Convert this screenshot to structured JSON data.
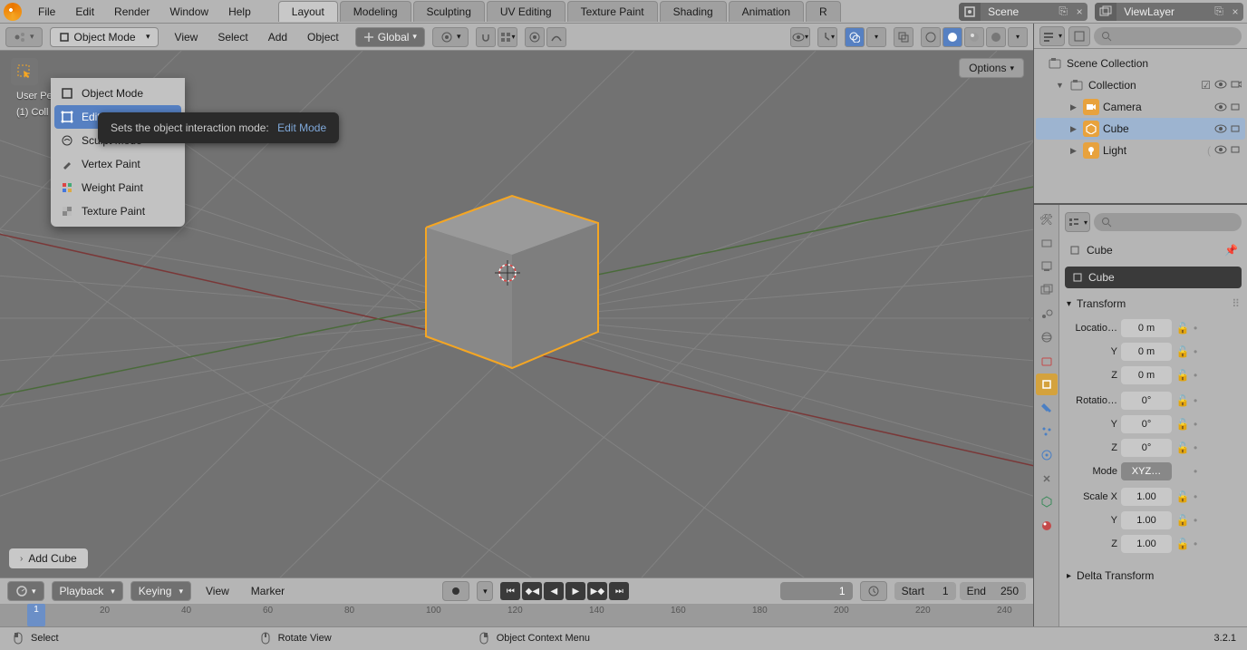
{
  "top_menu": {
    "file": "File",
    "edit": "Edit",
    "render": "Render",
    "window": "Window",
    "help": "Help"
  },
  "workspaces": {
    "layout": "Layout",
    "modeling": "Modeling",
    "sculpting": "Sculpting",
    "uv": "UV Editing",
    "texture": "Texture Paint",
    "shading": "Shading",
    "animation": "Animation",
    "more": "R"
  },
  "scene_name": "Scene",
  "view_layer": "ViewLayer",
  "mode_dropdown_label": "Object Mode",
  "vp_menu": {
    "view": "View",
    "select": "Select",
    "add": "Add",
    "object": "Object"
  },
  "orientation": "Global",
  "options_label": "Options",
  "overlay": {
    "line1": "User Pe",
    "line2": "(1) Coll"
  },
  "add_hint": "Add Cube",
  "mode_items": [
    {
      "label": "Object Mode",
      "hl": false,
      "icon": "cube"
    },
    {
      "label": "Edit Mode",
      "hl": true,
      "icon": "edit"
    },
    {
      "label": "Sculpt Mode",
      "hl": false,
      "icon": "sculpt"
    },
    {
      "label": "Vertex Paint",
      "hl": false,
      "icon": "vpaint"
    },
    {
      "label": "Weight Paint",
      "hl": false,
      "icon": "wpaint"
    },
    {
      "label": "Texture Paint",
      "hl": false,
      "icon": "tpaint"
    }
  ],
  "tooltip": {
    "text": "Sets the object interaction mode:",
    "value": "Edit Mode"
  },
  "timeline": {
    "playback": "Playback",
    "keying": "Keying",
    "view": "View",
    "marker": "Marker",
    "current": "1",
    "start_label": "Start",
    "start_val": "1",
    "end_label": "End",
    "end_val": "250",
    "ticks": [
      "20",
      "40",
      "60",
      "80",
      "100",
      "120",
      "140",
      "160",
      "180",
      "200",
      "220",
      "240"
    ]
  },
  "statusbar": {
    "select": "Select",
    "rotate": "Rotate View",
    "ctx": "Object Context Menu",
    "version": "3.2.1"
  },
  "outliner": {
    "root": "Scene Collection",
    "collection": "Collection",
    "items": [
      {
        "name": "Camera",
        "selected": false
      },
      {
        "name": "Cube",
        "selected": true
      },
      {
        "name": "Light",
        "selected": false
      }
    ]
  },
  "properties": {
    "breadcrumb": "Cube",
    "name": "Cube",
    "transform_label": "Transform",
    "delta_label": "Delta Transform",
    "location": {
      "label": "Locatio…",
      "x": "0 m",
      "y": "0 m",
      "z": "0 m"
    },
    "rotation": {
      "label": "Rotatio…",
      "x": "0°",
      "y": "0°",
      "z": "0°"
    },
    "mode_label": "Mode",
    "mode_value": "XYZ…",
    "scale": {
      "label": "Scale X",
      "x": "1.00",
      "y": "1.00",
      "z": "1.00"
    }
  }
}
